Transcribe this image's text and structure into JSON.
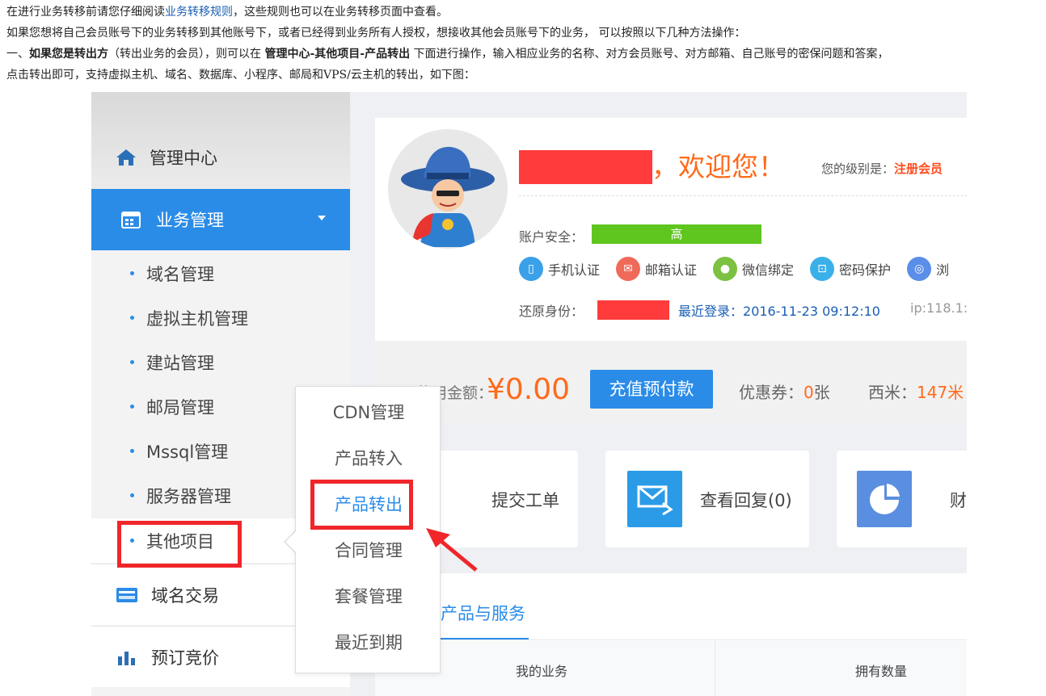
{
  "intro": {
    "line1_pre": "在进行业务转移前请您仔细阅读",
    "line1_link": "业务转移规则",
    "line1_post": "，这些规则也可以在业务转移页面中查看。",
    "line2": "如果您想将自己会员账号下的业务转移到其他账号下，或者已经得到业务所有人授权，想接收其他会员账号下的业务， 可以按照以下几种方法操作：",
    "line3_a": "一、",
    "line3_b": "如果您是转出方",
    "line3_c": "（转出业务的会员），则可以在 ",
    "line3_d": "管理中心-其他项目-产品转出",
    "line3_e": " 下面进行操作，输入相应业务的名称、对方会员账号、对方邮箱、自己账号的密保问题和答案，",
    "line4": "点击转出即可，支持虚拟主机、域名、数据库、小程序、邮局和VPS/云主机的转出，如下图："
  },
  "sidebar": {
    "home": "管理中心",
    "active": "业务管理",
    "subs": [
      "域名管理",
      "虚拟主机管理",
      "建站管理",
      "邮局管理",
      "Mssql管理",
      "服务器管理",
      "其他项目"
    ],
    "items": [
      "域名交易",
      "预订竞价"
    ]
  },
  "account": {
    "welcome": "，欢迎您！",
    "level_label": "您的级别是：",
    "level_value": "注册会员",
    "security_label": "账户安全：",
    "security_value": "高",
    "auths": [
      "手机认证",
      "邮箱认证",
      "微信绑定",
      "密码保护"
    ],
    "auth_last": "浏",
    "restore_label": "还原身份：",
    "last_login_label": "最近登录：",
    "last_login_value": "2016-11-23 09:12:10",
    "ip": "ip:118.1:",
    "colors": {
      "phone": "#3aa0e8",
      "mail": "#f06a5a",
      "wechat": "#7cc142",
      "lock": "#3ab0e8",
      "other": "#5a8ee8"
    }
  },
  "balance": {
    "label": "可使用金额：",
    "amount": "¥0.00",
    "recharge": "充值预付款",
    "coupon_label": "优惠券：",
    "coupon_value": "0",
    "coupon_unit": "张",
    "ximi_label": "西米：",
    "ximi_value": "147米"
  },
  "cards": [
    "提交工单",
    "查看回复(0)",
    "财"
  ],
  "products": {
    "tab": "的产品与服务",
    "th1": "我的业务",
    "th2": "拥有数量"
  },
  "dropdown": {
    "items": [
      "CDN管理",
      "产品转入",
      "产品转出",
      "合同管理",
      "套餐管理",
      "最近到期"
    ]
  },
  "accent": "#2b8ce8",
  "highlight": "#f0262a"
}
